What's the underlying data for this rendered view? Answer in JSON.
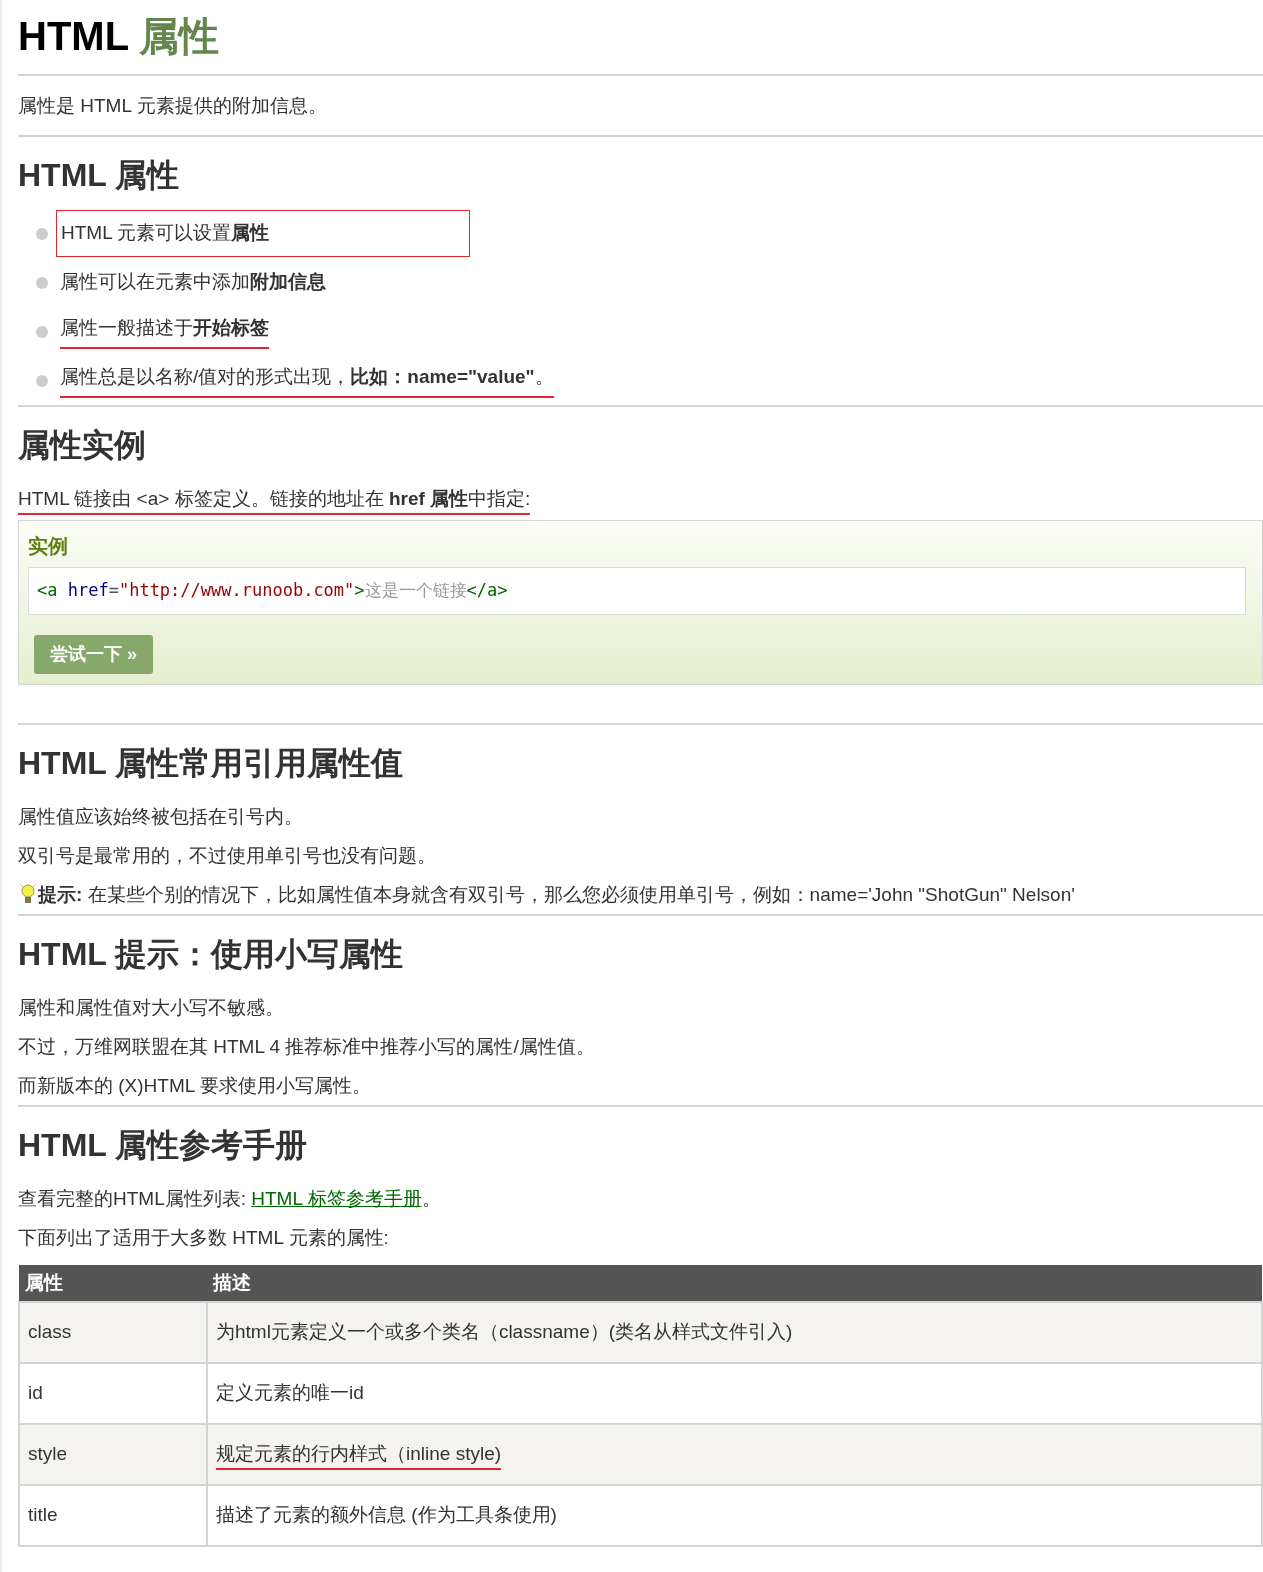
{
  "title": {
    "text": "HTML",
    "accent": "属性"
  },
  "intro": "属性是 HTML 元素提供的附加信息。",
  "sections": [
    {
      "heading": "HTML 属性",
      "blocks": [
        {
          "kind": "bullets",
          "items": [
            {
              "text": "HTML 元素可以设置**属性**",
              "boxed": true,
              "underlined": false
            },
            {
              "text": "属性可以在元素中添加**附加信息**",
              "boxed": false,
              "underlined": false
            },
            {
              "text": "属性一般描述于**开始标签**",
              "boxed": false,
              "underlined": true
            },
            {
              "text": "属性总是以名称/值对的形式出现，**比如：name=\"value\"**。",
              "boxed": false,
              "underlined": true
            }
          ]
        }
      ]
    },
    {
      "heading": "属性实例",
      "blocks": [
        {
          "kind": "para",
          "text": "HTML 链接由 <a> 标签定义。链接的地址在 **href 属性**中指定:",
          "underlined": true
        },
        {
          "kind": "example",
          "label": "实例",
          "code": [
            {
              "kind": "tag",
              "text": "<a"
            },
            {
              "kind": "attr",
              "text": " href"
            },
            {
              "kind": "punct",
              "text": "="
            },
            {
              "kind": "value",
              "text": "\"http://www.runoob.com\""
            },
            {
              "kind": "tag",
              "text": ">"
            },
            {
              "kind": "text",
              "text": "这是一个链接"
            },
            {
              "kind": "tag",
              "text": "</a>"
            }
          ],
          "button": "尝试一下 »"
        }
      ]
    },
    {
      "heading": "HTML 属性常用引用属性值",
      "blocks": [
        {
          "kind": "para",
          "text": "属性值应该始终被包括在引号内。",
          "underlined": false
        },
        {
          "kind": "para",
          "text": "双引号是最常用的，不过使用单引号也没有问题。",
          "underlined": false
        },
        {
          "kind": "tip",
          "text": "**提示:** 在某些个别的情况下，比如属性值本身就含有双引号，那么您必须使用单引号，例如：name='John \"ShotGun\" Nelson'"
        }
      ]
    },
    {
      "heading": "HTML 提示：使用小写属性",
      "blocks": [
        {
          "kind": "para",
          "text": "属性和属性值对大小写不敏感。",
          "underlined": false
        },
        {
          "kind": "para",
          "text": "不过，万维网联盟在其 HTML 4 推荐标准中推荐小写的属性/属性值。",
          "underlined": false
        },
        {
          "kind": "para",
          "text": "而新版本的 (X)HTML 要求使用小写属性。",
          "underlined": false
        }
      ]
    },
    {
      "heading": "HTML 属性参考手册",
      "blocks": [
        {
          "kind": "linkpara",
          "before": "查看完整的HTML属性列表: ",
          "link": "HTML 标签参考手册",
          "after": "。"
        },
        {
          "kind": "para",
          "text": "下面列出了适用于大多数 HTML 元素的属性:",
          "underlined": false
        },
        {
          "kind": "table",
          "columns": [
            "属性",
            "描述"
          ],
          "rows": [
            {
              "cells": [
                "class",
                "为html元素定义一个或多个类名（classname）(类名从样式文件引入)"
              ],
              "underlined": false
            },
            {
              "cells": [
                "id",
                "定义元素的唯一id"
              ],
              "underlined": false
            },
            {
              "cells": [
                "style",
                "规定元素的行内样式（inline style)"
              ],
              "underlined": true
            },
            {
              "cells": [
                "title",
                "描述了元素的额外信息 (作为工具条使用)"
              ],
              "underlined": false
            }
          ]
        }
      ]
    }
  ]
}
